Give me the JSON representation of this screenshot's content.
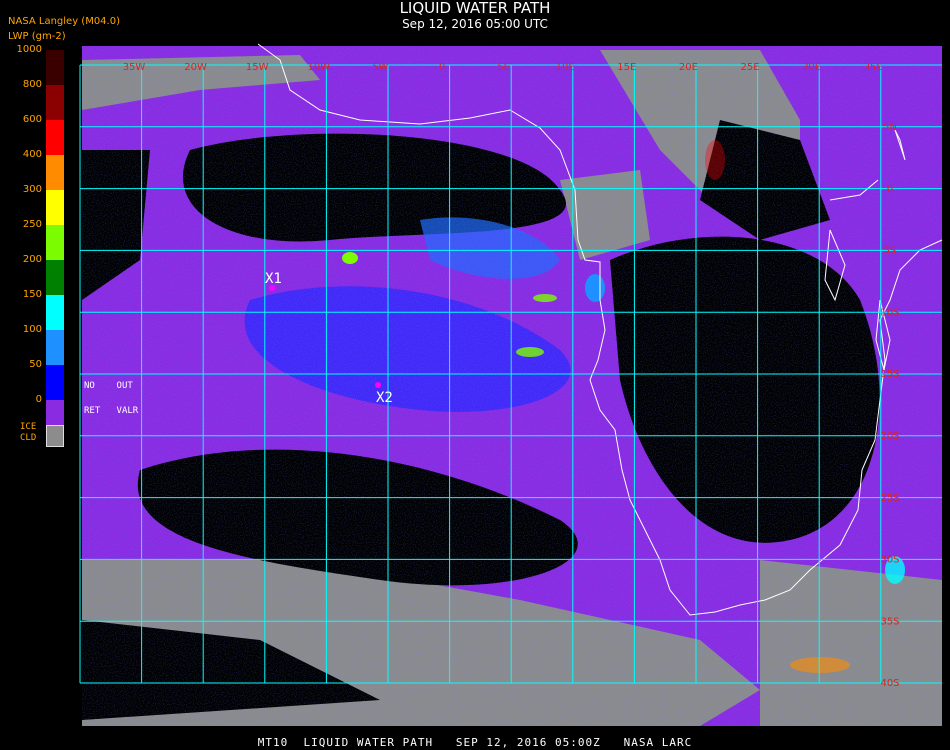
{
  "header": {
    "title": "LIQUID WATER PATH",
    "subtitle": "Sep 12, 2016 05:00 UTC",
    "source": "NASA Langley (M04.0)",
    "units": "LWP (gm-2)"
  },
  "legend": {
    "ticks": [
      "1000",
      "800",
      "600",
      "400",
      "300",
      "250",
      "200",
      "150",
      "100",
      "50",
      "0"
    ],
    "colors": [
      "#3a0000",
      "#8b0000",
      "#ff0000",
      "#ff8c00",
      "#ffff00",
      "#7cfc00",
      "#008000",
      "#00ffff",
      "#1e90ff",
      "#0000ff",
      "#8a2be2"
    ],
    "no_data": {
      "no": "NO",
      "out": "OUT",
      "ret": "RET",
      "valr": "VALR"
    },
    "ice_cloud": {
      "ice": "ICE",
      "cld": "CLD",
      "color": "#8c8c8c"
    }
  },
  "map": {
    "lon_labels": [
      "35W",
      "20W",
      "15W",
      "10W",
      "5W",
      "0",
      "5E",
      "10E",
      "15E",
      "20E",
      "25E",
      "30E",
      "35E"
    ],
    "lat_labels": [
      "5N",
      "0",
      "5S",
      "10S",
      "15S",
      "20S",
      "25S",
      "30S",
      "35S",
      "40S"
    ],
    "grid_color": "#00ffff",
    "label_color": "#e02020",
    "markers": [
      {
        "label": "X1",
        "color": "#ff00ff"
      },
      {
        "label": "X2",
        "color": "#ff00ff"
      }
    ]
  },
  "footer": "MT10  LIQUID WATER PATH   SEP 12, 2016 05:00Z   NASA LARC"
}
